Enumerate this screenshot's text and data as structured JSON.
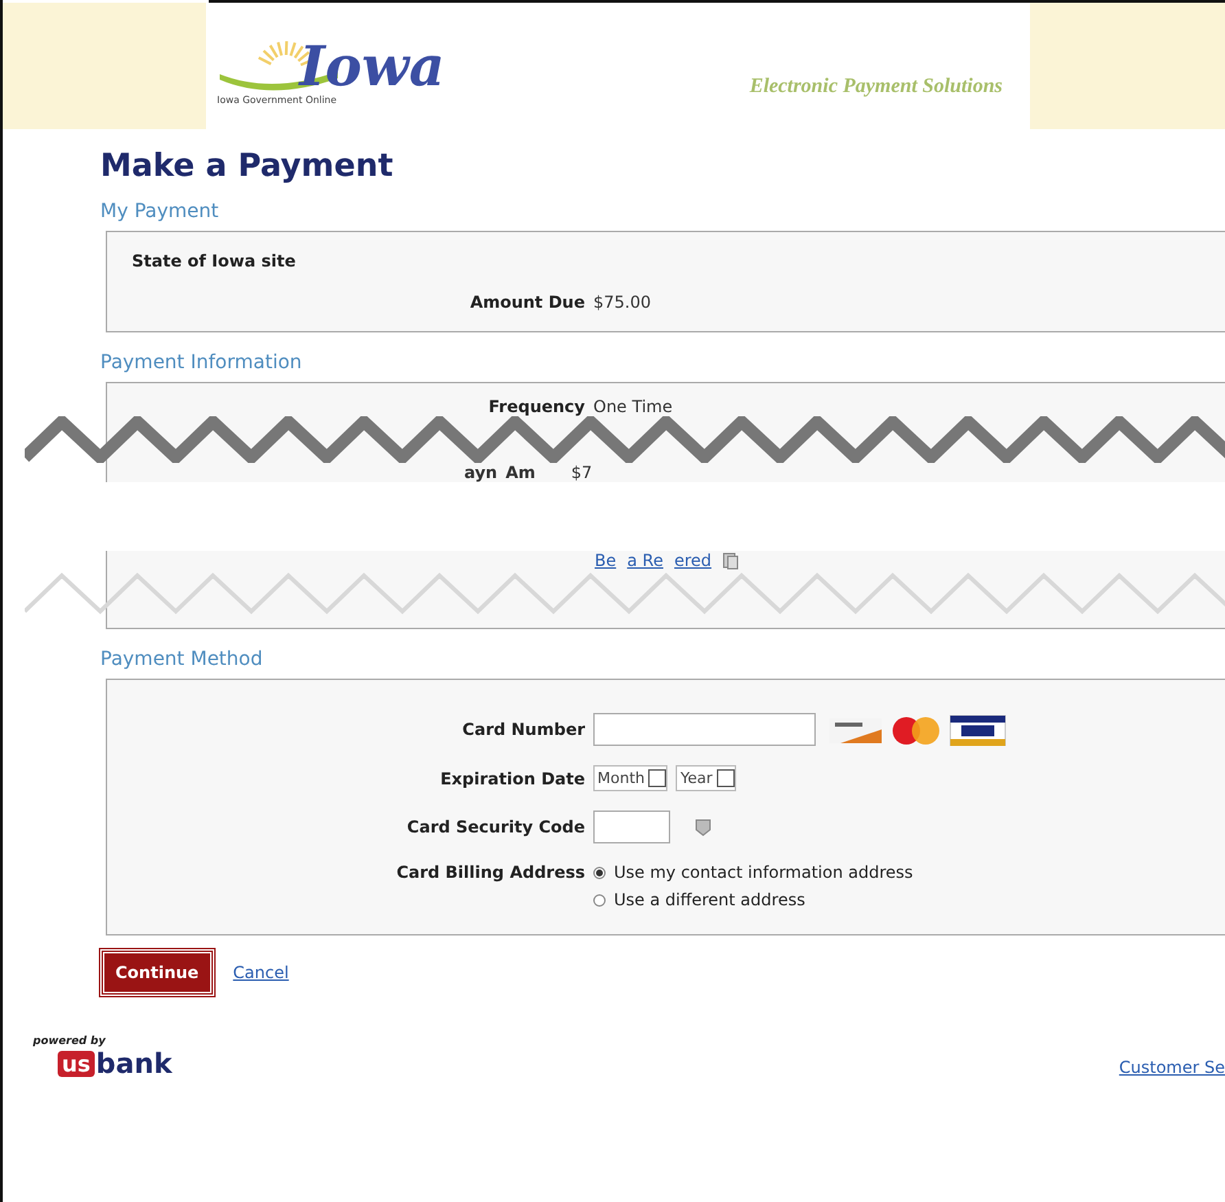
{
  "header": {
    "logo_word": "Iowa",
    "logo_tagline": "Iowa Government Online",
    "title": "Electronic Payment Solutions"
  },
  "page_title": "Make a Payment",
  "my_payment": {
    "heading": "My Payment",
    "site": "State of Iowa site",
    "rows": [
      {
        "label": "Amount Due",
        "value": "$75.00"
      }
    ]
  },
  "payment_information": {
    "heading": "Payment Information",
    "rows": [
      {
        "label": "Frequency",
        "value": "One Time"
      }
    ],
    "torn_row": {
      "label_parts": [
        "ayn",
        "Am"
      ],
      "value": "$7"
    },
    "torn_link_parts": [
      "Be",
      "a Re",
      "ered"
    ]
  },
  "payment_method": {
    "heading": "Payment Method",
    "card_number": {
      "label": "Card Number"
    },
    "expiration": {
      "label": "Expiration Date",
      "selects": [
        "Month",
        "Year"
      ]
    },
    "security_code": {
      "label": "Card Security Code"
    },
    "billing": {
      "label": "Card Billing Address",
      "options": [
        {
          "label": "Use my contact information address",
          "selected": true
        },
        {
          "label": "Use a different address",
          "selected": false
        }
      ]
    }
  },
  "actions": {
    "continue": "Continue",
    "cancel": "Cancel"
  },
  "footer": {
    "powered_by": "powered by",
    "bank_prefix": "us",
    "bank_name": "bank",
    "link": "Customer Se"
  }
}
